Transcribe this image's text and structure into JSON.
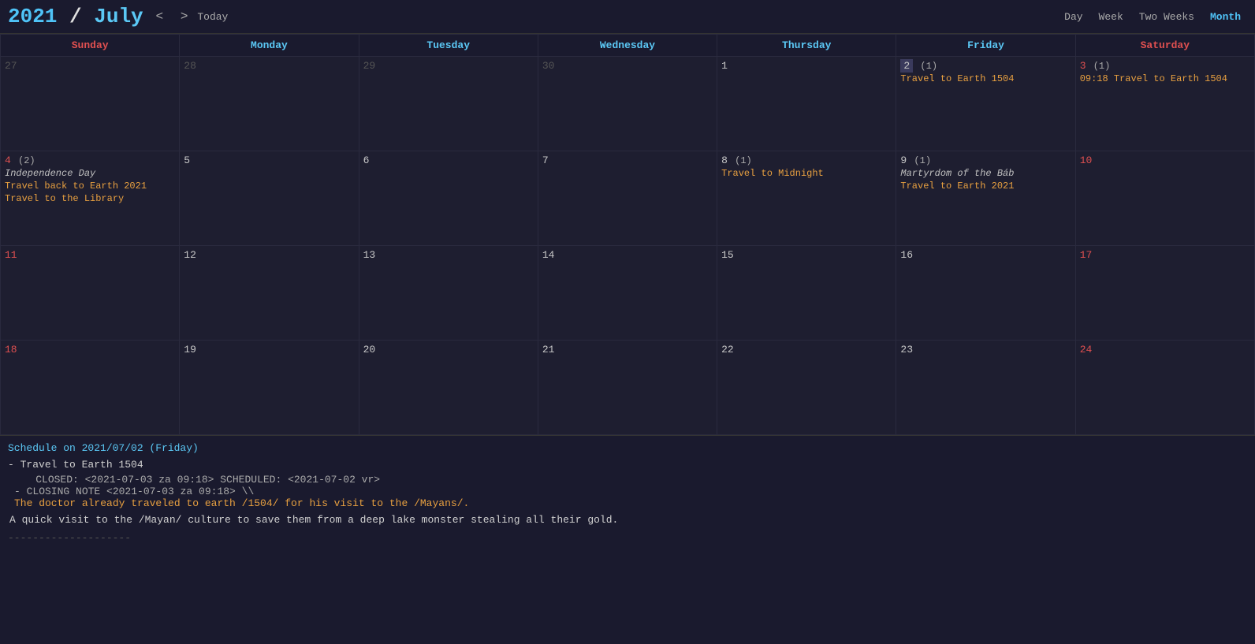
{
  "header": {
    "year": "2021",
    "separator": " / ",
    "month": "July",
    "prev_btn": "<",
    "next_btn": ">",
    "today_btn": "Today",
    "views": [
      "Day",
      "Week",
      "Two Weeks",
      "Month"
    ],
    "active_view": "Month"
  },
  "days_of_week": [
    {
      "label": "Sunday",
      "class": "th-sun"
    },
    {
      "label": "Monday",
      "class": "th-mon"
    },
    {
      "label": "Tuesday",
      "class": "th-tue"
    },
    {
      "label": "Wednesday",
      "class": "th-wed"
    },
    {
      "label": "Thursday",
      "class": "th-thu"
    },
    {
      "label": "Friday",
      "class": "th-fri"
    },
    {
      "label": "Saturday",
      "class": "th-sat"
    }
  ],
  "weeks": [
    {
      "days": [
        {
          "num": "27",
          "extra": "",
          "weekend": false,
          "other": true,
          "today": false,
          "events": []
        },
        {
          "num": "28",
          "extra": "",
          "weekend": false,
          "other": true,
          "today": false,
          "events": []
        },
        {
          "num": "29",
          "extra": "",
          "weekend": false,
          "other": true,
          "today": false,
          "events": []
        },
        {
          "num": "30",
          "extra": "",
          "weekend": false,
          "other": true,
          "today": false,
          "events": []
        },
        {
          "num": "1",
          "extra": "",
          "weekend": false,
          "other": false,
          "today": false,
          "events": []
        },
        {
          "num": "2",
          "extra": "(1)",
          "weekend": false,
          "other": false,
          "today": true,
          "events": [
            {
              "text": "Travel to Earth 1504",
              "class": "orange"
            }
          ]
        },
        {
          "num": "3",
          "extra": "(1)",
          "weekend": true,
          "other": false,
          "today": false,
          "events": [
            {
              "text": "09:18 Travel to Earth 1504",
              "class": "orange"
            }
          ]
        }
      ]
    },
    {
      "days": [
        {
          "num": "4",
          "extra": "(2)",
          "weekend": true,
          "other": false,
          "today": false,
          "events": [
            {
              "text": "Independence Day",
              "class": "holiday"
            },
            {
              "text": "Travel back to Earth 2021",
              "class": "orange"
            },
            {
              "text": "Travel to the Library",
              "class": "orange"
            }
          ]
        },
        {
          "num": "5",
          "extra": "",
          "weekend": false,
          "other": false,
          "today": false,
          "events": []
        },
        {
          "num": "6",
          "extra": "",
          "weekend": false,
          "other": false,
          "today": false,
          "events": []
        },
        {
          "num": "7",
          "extra": "",
          "weekend": false,
          "other": false,
          "today": false,
          "events": []
        },
        {
          "num": "8",
          "extra": "(1)",
          "weekend": false,
          "other": false,
          "today": false,
          "events": [
            {
              "text": "Travel to Midnight",
              "class": "orange"
            }
          ]
        },
        {
          "num": "9",
          "extra": "(1)",
          "weekend": false,
          "other": false,
          "today": false,
          "events": [
            {
              "text": "Martyrdom of the Báb",
              "class": "holiday"
            },
            {
              "text": "Travel to Earth 2021",
              "class": "orange"
            }
          ]
        },
        {
          "num": "10",
          "extra": "",
          "weekend": true,
          "other": false,
          "today": false,
          "events": []
        }
      ]
    },
    {
      "days": [
        {
          "num": "11",
          "extra": "",
          "weekend": true,
          "other": false,
          "today": false,
          "events": []
        },
        {
          "num": "12",
          "extra": "",
          "weekend": false,
          "other": false,
          "today": false,
          "events": []
        },
        {
          "num": "13",
          "extra": "",
          "weekend": false,
          "other": false,
          "today": false,
          "events": []
        },
        {
          "num": "14",
          "extra": "",
          "weekend": false,
          "other": false,
          "today": false,
          "events": []
        },
        {
          "num": "15",
          "extra": "",
          "weekend": false,
          "other": false,
          "today": false,
          "events": []
        },
        {
          "num": "16",
          "extra": "",
          "weekend": false,
          "other": false,
          "today": false,
          "events": []
        },
        {
          "num": "17",
          "extra": "",
          "weekend": true,
          "other": false,
          "today": false,
          "events": []
        }
      ]
    },
    {
      "days": [
        {
          "num": "18",
          "extra": "",
          "weekend": true,
          "other": false,
          "today": false,
          "events": []
        },
        {
          "num": "19",
          "extra": "",
          "weekend": false,
          "other": false,
          "today": false,
          "events": []
        },
        {
          "num": "20",
          "extra": "",
          "weekend": false,
          "other": false,
          "today": false,
          "events": []
        },
        {
          "num": "21",
          "extra": "",
          "weekend": false,
          "other": false,
          "today": false,
          "events": []
        },
        {
          "num": "22",
          "extra": "",
          "weekend": false,
          "other": false,
          "today": false,
          "events": []
        },
        {
          "num": "23",
          "extra": "",
          "weekend": false,
          "other": false,
          "today": false,
          "events": []
        },
        {
          "num": "24",
          "extra": "",
          "weekend": true,
          "other": false,
          "today": false,
          "events": []
        }
      ]
    }
  ],
  "schedule": {
    "title": "Schedule on 2021/07/02 (Friday)",
    "items": [
      {
        "name": "Travel to Earth 1504",
        "closed": "CLOSED: <2021-07-03 za 09:18> SCHEDULED: <2021-07-02 vr>",
        "closing_note_label": "- CLOSING NOTE <2021-07-03 za 09:18> \\\\",
        "note_text": "      The doctor already traveled to earth /1504/ for his visit to the /Mayans/.",
        "description": "  A quick visit to the /Mayan/ culture to save them from a deep lake monster stealing all their gold."
      }
    ],
    "separator": "--------------------"
  },
  "popup": {
    "visible": true,
    "day": "2",
    "title": "Travel to Earth 1504",
    "event1": "Martyrdom of the Bab",
    "event2": "Travel to Earth 2021"
  }
}
